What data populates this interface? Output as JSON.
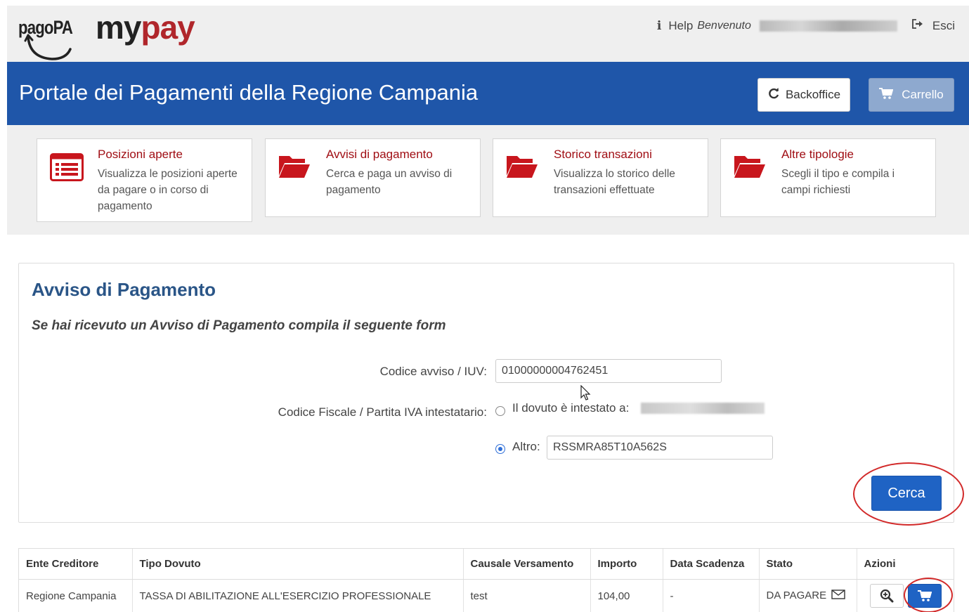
{
  "header": {
    "pagopa_logo": "pagoPA",
    "mypay_logo_my": "my",
    "mypay_logo_pay": "pay",
    "help_label": "Help",
    "welcome_label": "Benvenuto",
    "logout_label": "Esci"
  },
  "portal": {
    "title": "Portale dei Pagamenti della Regione Campania",
    "backoffice_label": "Backoffice",
    "cart_label": "Carrello"
  },
  "tiles": [
    {
      "title": "Posizioni aperte",
      "description": "Visualizza le posizioni aperte da pagare o in corso di pagamento",
      "icon": "list-icon"
    },
    {
      "title": "Avvisi di pagamento",
      "description": "Cerca e paga un avviso di pagamento",
      "icon": "folder-open-icon"
    },
    {
      "title": "Storico transazioni",
      "description": "Visualizza lo storico delle transazioni effettuate",
      "icon": "folder-open-icon"
    },
    {
      "title": "Altre tipologie",
      "description": "Scegli il tipo e compila i campi richiesti",
      "icon": "folder-open-icon"
    }
  ],
  "form": {
    "title": "Avviso di Pagamento",
    "subtitle": "Se hai ricevuto un Avviso di Pagamento compila il seguente form",
    "iuv_label": "Codice avviso / IUV:",
    "iuv_value": "01000000004762451",
    "cf_label": "Codice Fiscale / Partita IVA intestatario:",
    "option_self": "Il dovuto è intestato a:",
    "option_other": "Altro:",
    "other_value": "RSSMRA85T10A562S",
    "search_label": "Cerca"
  },
  "table": {
    "columns": [
      "Ente Creditore",
      "Tipo Dovuto",
      "Causale Versamento",
      "Importo",
      "Data Scadenza",
      "Stato",
      "Azioni"
    ],
    "rows": [
      [
        "Regione Campania",
        "TASSA DI ABILITAZIONE ALL'ESERCIZIO PROFESSIONALE",
        "test",
        "104,00",
        "-",
        "DA PAGARE",
        ""
      ]
    ]
  },
  "colors": {
    "brand_blue": "#1f56a9",
    "accent_red": "#a00e14",
    "button_blue": "#1f63c4",
    "highlight_red": "#d22a2a"
  }
}
